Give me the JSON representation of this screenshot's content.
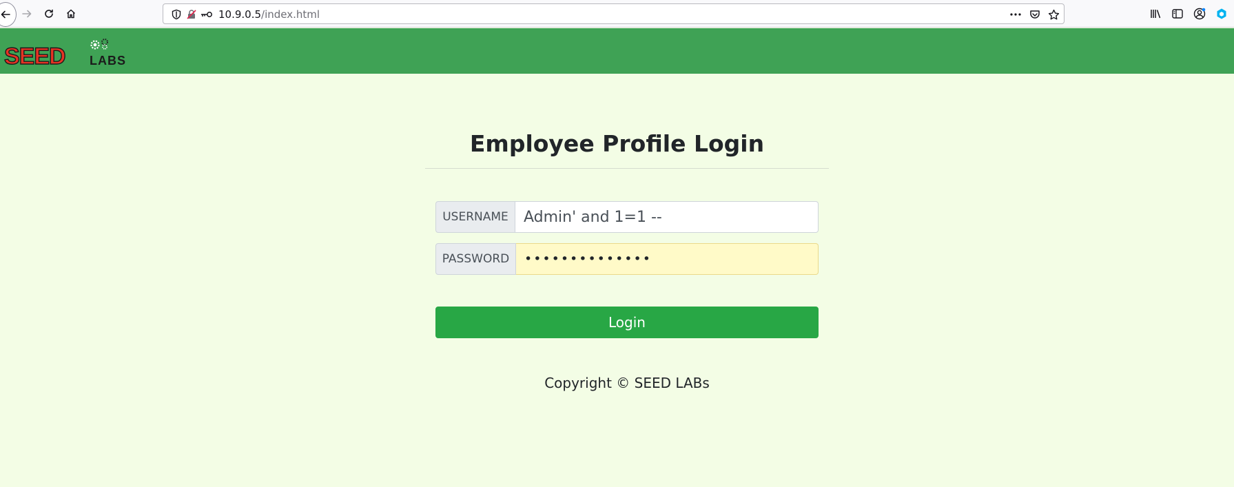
{
  "browser": {
    "url_host": "10.9.0.5",
    "url_path": "/index.html"
  },
  "navbar": {
    "logo_seed": "SEED",
    "logo_labs": "LABS"
  },
  "login": {
    "title": "Employee Profile Login",
    "username_label": "USERNAME",
    "username_value": "Admin' and 1=1 --",
    "password_label": "PASSWORD",
    "password_masked": "••••••••••••••",
    "button_label": "Login"
  },
  "footer": {
    "copyright": "Copyright © SEED LABs"
  },
  "colors": {
    "page_background": "#f3fde5",
    "navbar": "#3fa255",
    "login_button": "#28a745",
    "password_autofill": "#fffac8"
  }
}
